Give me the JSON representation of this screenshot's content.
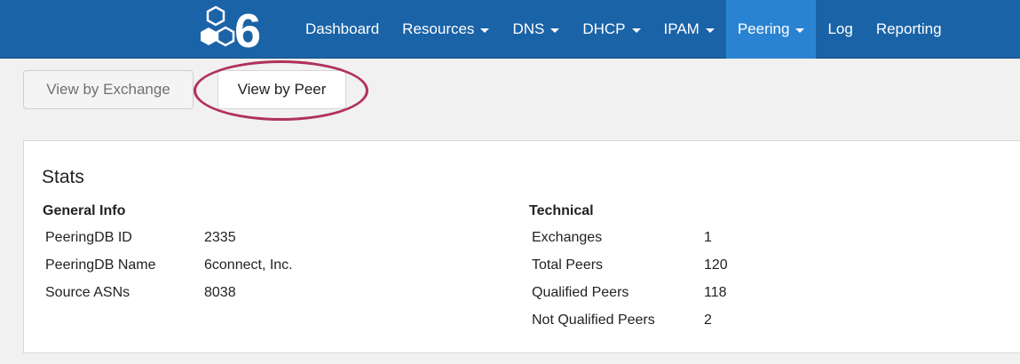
{
  "brand": {
    "logo_text": "6",
    "colors": {
      "navbar": "#1b63a7",
      "active": "#2a83d2",
      "logo": "#ffffff"
    }
  },
  "nav": {
    "items": [
      {
        "label": "Dashboard",
        "dropdown": false,
        "active": false
      },
      {
        "label": "Resources",
        "dropdown": true,
        "active": false
      },
      {
        "label": "DNS",
        "dropdown": true,
        "active": false
      },
      {
        "label": "DHCP",
        "dropdown": true,
        "active": false
      },
      {
        "label": "IPAM",
        "dropdown": true,
        "active": false
      },
      {
        "label": "Peering",
        "dropdown": true,
        "active": true
      },
      {
        "label": "Log",
        "dropdown": false,
        "active": false
      },
      {
        "label": "Reporting",
        "dropdown": false,
        "active": false
      }
    ]
  },
  "view_toggle": {
    "exchange_label": "View by Exchange",
    "peer_label": "View by Peer",
    "selected": "View by Peer",
    "highlight_color": "#b0315f"
  },
  "stats": {
    "title": "Stats",
    "general": {
      "heading": "General Info",
      "rows": [
        {
          "key": "PeeringDB ID",
          "value": "2335"
        },
        {
          "key": "PeeringDB Name",
          "value": "6connect, Inc."
        },
        {
          "key": "Source ASNs",
          "value": "8038"
        }
      ]
    },
    "technical": {
      "heading": "Technical",
      "rows": [
        {
          "key": "Exchanges",
          "value": "1"
        },
        {
          "key": "Total Peers",
          "value": "120"
        },
        {
          "key": "Qualified Peers",
          "value": "118"
        },
        {
          "key": "Not Qualified Peers",
          "value": "2"
        }
      ]
    }
  }
}
